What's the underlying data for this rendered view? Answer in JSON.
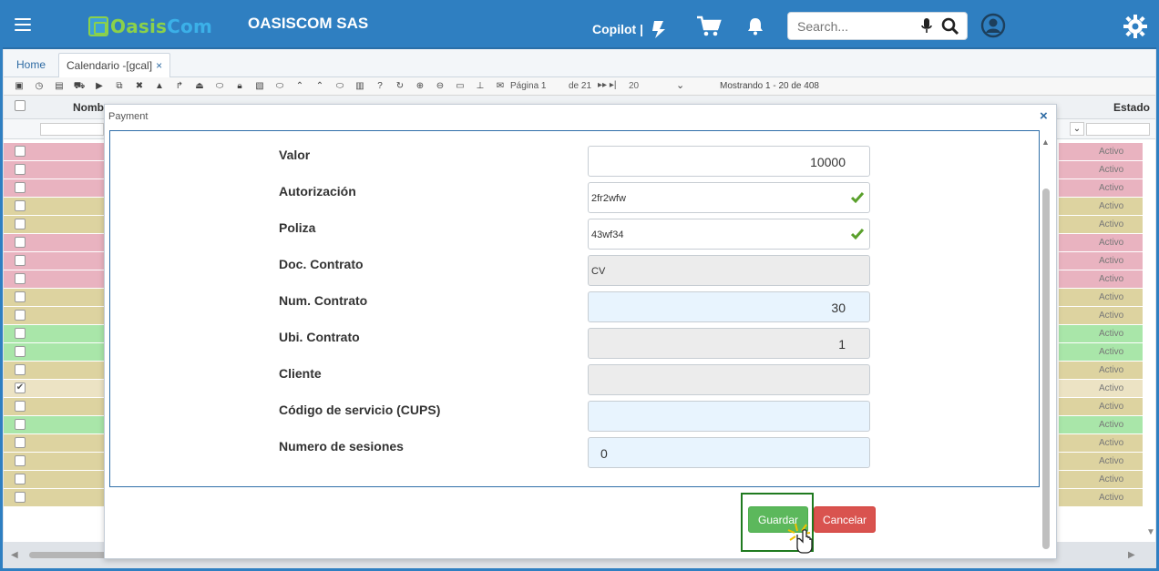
{
  "header": {
    "logo_text_a": "Oasis",
    "logo_text_b": "Com",
    "company": "OASISCOM SAS",
    "copilot_label": "Copilot |",
    "search_placeholder": "Search..."
  },
  "tabs": [
    {
      "label": "Home"
    },
    {
      "label": "Calendario -[gcal]",
      "close": "×"
    }
  ],
  "toolbar": {
    "page_label": "Página 1",
    "page_total": "de 21",
    "page_size": "20",
    "showing": "Mostrando 1 - 20 de 408"
  },
  "grid": {
    "col_name": "Nombr",
    "col_state": "Estado",
    "rows": [
      {
        "color": "red",
        "status": "Activo",
        "checked": false
      },
      {
        "color": "red",
        "status": "Activo",
        "checked": false
      },
      {
        "color": "red",
        "status": "Activo",
        "checked": false
      },
      {
        "color": "tan",
        "status": "Activo",
        "checked": false
      },
      {
        "color": "tan",
        "status": "Activo",
        "checked": false
      },
      {
        "color": "red",
        "status": "Activo",
        "checked": false
      },
      {
        "color": "red",
        "status": "Activo",
        "checked": false
      },
      {
        "color": "red",
        "status": "Activo",
        "checked": false
      },
      {
        "color": "tan",
        "status": "Activo",
        "checked": false
      },
      {
        "color": "tan",
        "status": "Activo",
        "checked": false
      },
      {
        "color": "grn",
        "status": "Activo",
        "checked": false
      },
      {
        "color": "grn",
        "status": "Activo",
        "checked": false
      },
      {
        "color": "tan",
        "status": "Activo",
        "checked": false
      },
      {
        "color": "sel",
        "status": "Activo",
        "checked": true
      },
      {
        "color": "tan",
        "status": "Activo",
        "checked": false
      },
      {
        "color": "grn",
        "status": "Activo",
        "checked": false
      },
      {
        "color": "tan",
        "status": "Activo",
        "checked": false
      },
      {
        "color": "tan",
        "status": "Activo",
        "checked": false
      },
      {
        "color": "tan",
        "status": "Activo",
        "checked": false
      },
      {
        "color": "tan",
        "status": "Activo",
        "checked": false
      }
    ]
  },
  "modal": {
    "title": "Payment",
    "close": "×",
    "fields": {
      "valor": {
        "label": "Valor",
        "value": "10000"
      },
      "autorizacion": {
        "label": "Autorización",
        "value": "2fr2wfw"
      },
      "poliza": {
        "label": "Poliza",
        "value": "43wf34"
      },
      "doc_contrato": {
        "label": "Doc. Contrato",
        "value": "CV"
      },
      "num_contrato": {
        "label": "Num. Contrato",
        "value": "30"
      },
      "ubi_contrato": {
        "label": "Ubi. Contrato",
        "value": "1"
      },
      "cliente": {
        "label": "Cliente",
        "value": ""
      },
      "cups": {
        "label": "Código de servicio (CUPS)",
        "value": ""
      },
      "sesiones": {
        "label": "Numero de sesiones",
        "value": "0"
      }
    },
    "save_label": "Guardar",
    "cancel_label": "Cancelar"
  },
  "colors": {
    "header_blue": "#2f7fc1",
    "save_green": "#5cb85c",
    "cancel_red": "#d9534f",
    "row_red": "#e9b3c0",
    "row_tan": "#ddd3a0",
    "row_green": "#a9e6a9",
    "check_green": "#5aa02c"
  }
}
